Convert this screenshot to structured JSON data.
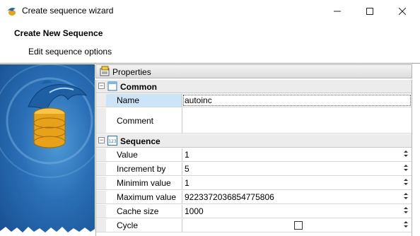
{
  "window": {
    "title": "Create sequence wizard",
    "controls": {
      "minimize_icon": "minimize-icon",
      "maximize_icon": "maximize-icon",
      "close_icon": "close-icon"
    }
  },
  "header": {
    "title": "Create New Sequence",
    "subtitle": "Edit sequence options"
  },
  "properties_panel": {
    "title": "Properties",
    "categories": [
      {
        "label": "Common",
        "expanded": true,
        "items": [
          {
            "name": "Name",
            "value": "autoinc"
          },
          {
            "name": "Comment",
            "value": ""
          }
        ]
      },
      {
        "label": "Sequence",
        "expanded": true,
        "items": [
          {
            "name": "Value",
            "value": "1"
          },
          {
            "name": "Increment by",
            "value": "5"
          },
          {
            "name": "Minimim value",
            "value": "1"
          },
          {
            "name": "Maximum value",
            "value": "9223372036854775806"
          },
          {
            "name": "Cache size",
            "value": "1000"
          },
          {
            "name": "Cycle",
            "value": "",
            "checked": false
          }
        ]
      }
    ]
  },
  "colors": {
    "selection": "#cce4f7",
    "category_band": "#ececec",
    "side_panel": "#2a6fb6"
  }
}
